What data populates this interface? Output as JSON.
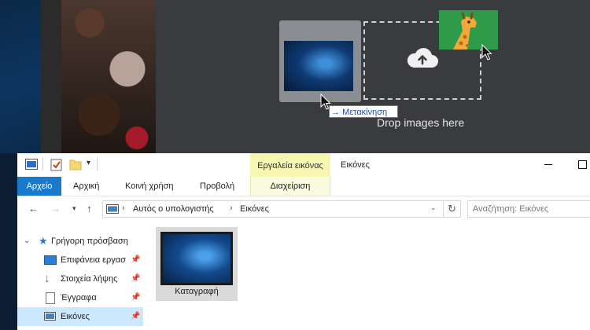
{
  "upload": {
    "drop_text": "Drop images here",
    "move_tooltip": "Μετακίνηση"
  },
  "explorer": {
    "window_title": "Εικόνες",
    "context_tab_group": "Εργαλεία εικόνας",
    "tabs": {
      "file": "Αρχείο",
      "home": "Αρχική",
      "share": "Κοινή χρήση",
      "view": "Προβολή",
      "manage": "Διαχείριση"
    },
    "address": {
      "crumbs": [
        "Αυτός ο υπολογιστής",
        "Εικόνες"
      ]
    },
    "search": {
      "placeholder": "Αναζήτηση: Εικόνες"
    },
    "nav": {
      "quick_access": "Γρήγορη πρόσβαση",
      "items": [
        "Επιφάνεια εργασ",
        "Στοιχεία λήψης",
        "Έγγραφα",
        "Εικόνες"
      ]
    },
    "files": [
      {
        "name": "Καταγραφή"
      }
    ]
  },
  "colors": {
    "accent": "#1979ca",
    "context_tab": "#f6f6b1",
    "selected": "#cce8ff",
    "upload_bg": "#3a3b3e"
  }
}
